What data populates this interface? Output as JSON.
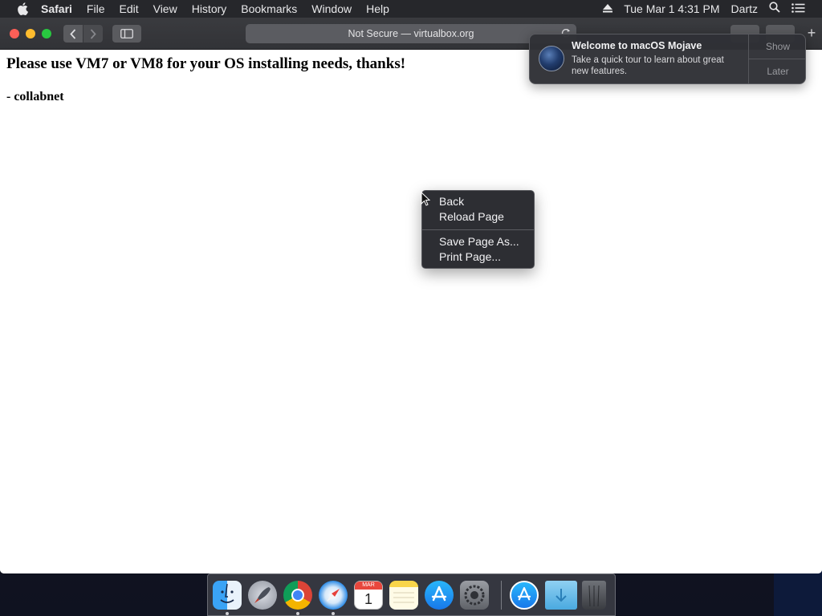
{
  "menubar": {
    "app_name": "Safari",
    "menus": [
      "File",
      "Edit",
      "View",
      "History",
      "Bookmarks",
      "Window",
      "Help"
    ],
    "clock": "Tue Mar 1  4:31 PM",
    "user": "Dartz"
  },
  "browser": {
    "address": "Not Secure — virtualbox.org"
  },
  "page": {
    "heading": "Please use VM7 or VM8 for your OS installing needs, thanks!",
    "signature": "- collabnet"
  },
  "context_menu": {
    "items": [
      "Back",
      "Reload Page",
      "Save Page As...",
      "Print Page..."
    ]
  },
  "notification": {
    "title": "Welcome to macOS Mojave",
    "body": "Take a quick tour to learn about great new features.",
    "show_label": "Show",
    "later_label": "Later"
  },
  "dock": {
    "items": [
      "Finder",
      "Launchpad",
      "Google Chrome",
      "Safari",
      "Calendar",
      "Notes",
      "App Store",
      "System Preferences",
      "App Store",
      "Downloads",
      "Trash"
    ],
    "calendar_month": "MAR",
    "calendar_day": "1"
  },
  "colors": {
    "close": "#fe5f57",
    "minimize": "#febc2e",
    "maximize": "#28c840",
    "menubar": "#26272b",
    "toolbar": "#3a3b3f"
  }
}
